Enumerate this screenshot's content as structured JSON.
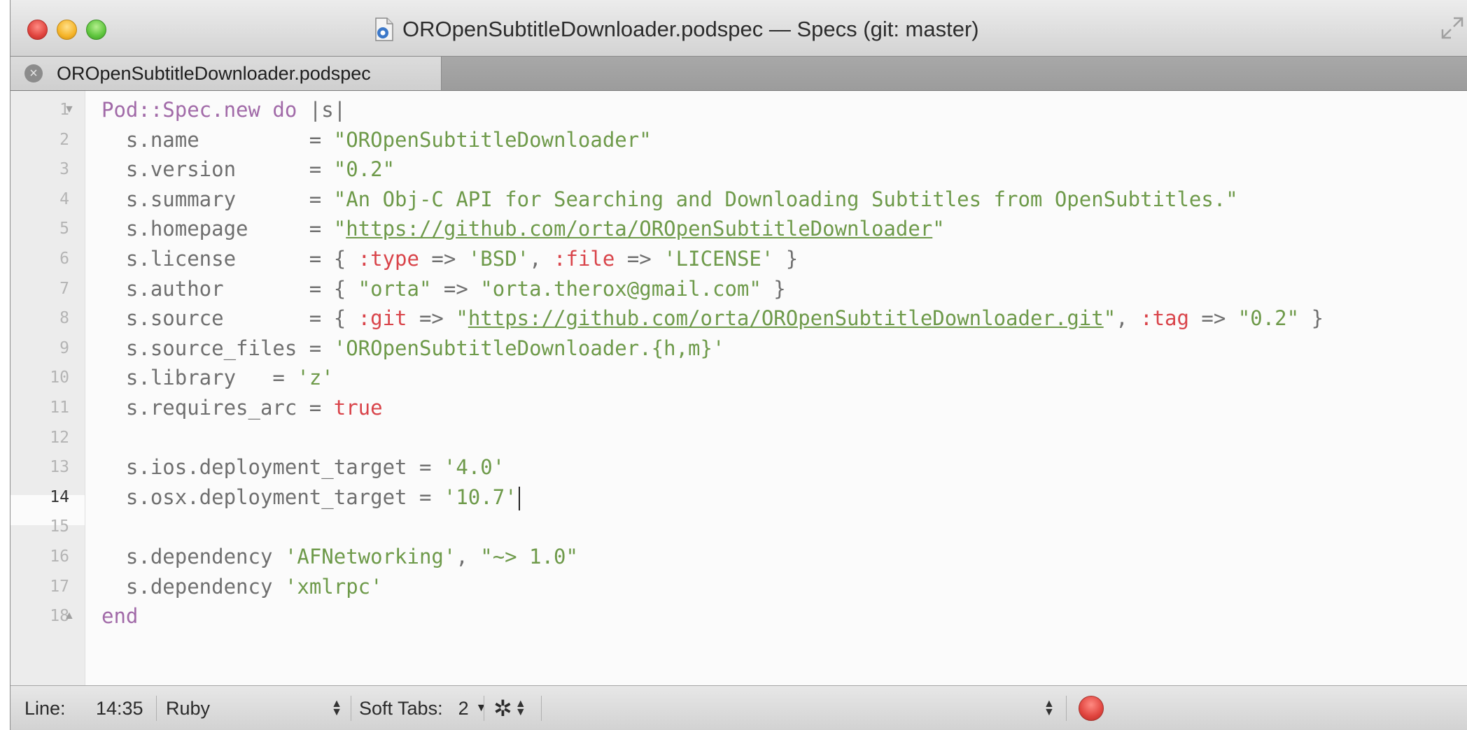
{
  "window": {
    "title": "OROpenSubtitleDownloader.podspec — Specs (git: master)"
  },
  "tab": {
    "label": "OROpenSubtitleDownloader.podspec"
  },
  "editor": {
    "line_numbers": [
      "1",
      "2",
      "3",
      "4",
      "5",
      "6",
      "7",
      "8",
      "9",
      "10",
      "11",
      "12",
      "13",
      "14",
      "15",
      "16",
      "17",
      "18"
    ],
    "current_line": "14",
    "lines": [
      [
        {
          "t": "Pod::Spec.new do ",
          "c": "kw"
        },
        {
          "t": "|s|",
          "c": "plain"
        }
      ],
      [
        {
          "t": "  s.name         = ",
          "c": "plain"
        },
        {
          "t": "\"OROpenSubtitleDownloader\"",
          "c": "str"
        }
      ],
      [
        {
          "t": "  s.version      = ",
          "c": "plain"
        },
        {
          "t": "\"0.2\"",
          "c": "str"
        }
      ],
      [
        {
          "t": "  s.summary      = ",
          "c": "plain"
        },
        {
          "t": "\"An Obj-C API for Searching and Downloading Subtitles from OpenSubtitles.\"",
          "c": "str"
        }
      ],
      [
        {
          "t": "  s.homepage     = ",
          "c": "plain"
        },
        {
          "t": "\"",
          "c": "str"
        },
        {
          "t": "https://github.com/orta/OROpenSubtitleDownloader",
          "c": "link"
        },
        {
          "t": "\"",
          "c": "str"
        }
      ],
      [
        {
          "t": "  s.license      = { ",
          "c": "plain"
        },
        {
          "t": ":type",
          "c": "sym"
        },
        {
          "t": " => ",
          "c": "plain"
        },
        {
          "t": "'BSD'",
          "c": "str"
        },
        {
          "t": ", ",
          "c": "plain"
        },
        {
          "t": ":file",
          "c": "sym"
        },
        {
          "t": " => ",
          "c": "plain"
        },
        {
          "t": "'LICENSE'",
          "c": "str"
        },
        {
          "t": " }",
          "c": "plain"
        }
      ],
      [
        {
          "t": "  s.author       = { ",
          "c": "plain"
        },
        {
          "t": "\"orta\"",
          "c": "str"
        },
        {
          "t": " => ",
          "c": "plain"
        },
        {
          "t": "\"orta.therox@gmail.com\"",
          "c": "str"
        },
        {
          "t": " }",
          "c": "plain"
        }
      ],
      [
        {
          "t": "  s.source       = { ",
          "c": "plain"
        },
        {
          "t": ":git",
          "c": "sym"
        },
        {
          "t": " => ",
          "c": "plain"
        },
        {
          "t": "\"",
          "c": "str"
        },
        {
          "t": "https://github.com/orta/OROpenSubtitleDownloader.git",
          "c": "link"
        },
        {
          "t": "\"",
          "c": "str"
        },
        {
          "t": ", ",
          "c": "plain"
        },
        {
          "t": ":tag",
          "c": "sym"
        },
        {
          "t": " => ",
          "c": "plain"
        },
        {
          "t": "\"0.2\"",
          "c": "str"
        },
        {
          "t": " }",
          "c": "plain"
        }
      ],
      [
        {
          "t": "  s.source_files = ",
          "c": "plain"
        },
        {
          "t": "'OROpenSubtitleDownloader.{h,m}'",
          "c": "str"
        }
      ],
      [
        {
          "t": "  s.library   = ",
          "c": "plain"
        },
        {
          "t": "'z'",
          "c": "str"
        }
      ],
      [
        {
          "t": "  s.requires_arc = ",
          "c": "plain"
        },
        {
          "t": "true",
          "c": "sym"
        }
      ],
      [
        {
          "t": "",
          "c": "plain"
        }
      ],
      [
        {
          "t": "  s.ios.deployment_target = ",
          "c": "plain"
        },
        {
          "t": "'4.0'",
          "c": "str"
        }
      ],
      [
        {
          "t": "  s.osx.deployment_target = ",
          "c": "plain"
        },
        {
          "t": "'10.7'",
          "c": "str"
        },
        {
          "t": "",
          "c": "cursor"
        }
      ],
      [
        {
          "t": "",
          "c": "plain"
        }
      ],
      [
        {
          "t": "  s.dependency ",
          "c": "plain"
        },
        {
          "t": "'AFNetworking'",
          "c": "str"
        },
        {
          "t": ", ",
          "c": "plain"
        },
        {
          "t": "\"~> 1.0\"",
          "c": "str"
        }
      ],
      [
        {
          "t": "  s.dependency ",
          "c": "plain"
        },
        {
          "t": "'xmlrpc'",
          "c": "str"
        }
      ],
      [
        {
          "t": "end",
          "c": "kw"
        }
      ]
    ]
  },
  "statusbar": {
    "line_label": "Line:",
    "position": "14:35",
    "language": "Ruby",
    "soft_tabs_label": "Soft Tabs:",
    "soft_tabs_value": "2"
  },
  "colors": {
    "keyword": "#a16aa8",
    "string": "#6e9a4a",
    "symbol": "#d9444a",
    "plain": "#6f6f6f"
  }
}
